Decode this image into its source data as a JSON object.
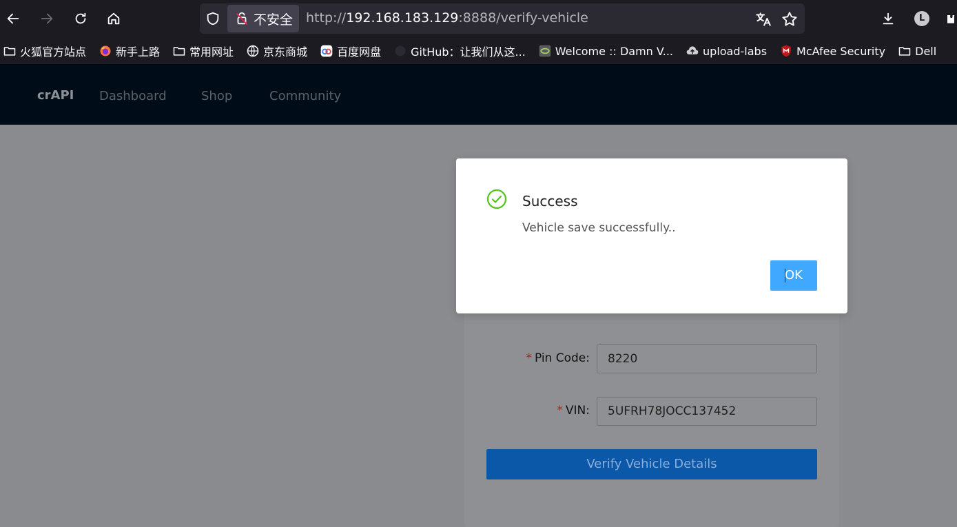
{
  "browser": {
    "security_label": "不安全",
    "url_prefix": "http://",
    "url_host": "192.168.183.129",
    "url_rest": ":8888/verify-vehicle",
    "profile_initial": "L"
  },
  "bookmarks": [
    {
      "label": "火狐官方站点",
      "icon": "folder-icon"
    },
    {
      "label": "新手上路",
      "icon": "firefox-icon"
    },
    {
      "label": "常用网址",
      "icon": "folder-icon"
    },
    {
      "label": "京东商城",
      "icon": "globe-icon"
    },
    {
      "label": "百度网盘",
      "icon": "baidu-pan-icon"
    },
    {
      "label": "GitHub：让我们从这...",
      "icon": "github-icon"
    },
    {
      "label": "Welcome :: Damn V...",
      "icon": "dvwa-icon"
    },
    {
      "label": "upload-labs",
      "icon": "upload-icon"
    },
    {
      "label": "McAfee Security",
      "icon": "mcafee-icon"
    },
    {
      "label": "Dell",
      "icon": "folder-icon"
    }
  ],
  "app": {
    "brand": "crAPI",
    "nav": [
      "Dashboard",
      "Shop",
      "Community"
    ]
  },
  "form": {
    "pin_label": "Pin Code",
    "pin_value": "8220",
    "vin_label": "VIN",
    "vin_value": "5UFRH78JOCC137452",
    "submit_label": "Verify Vehicle Details",
    "colon": ":"
  },
  "modal": {
    "title": "Success",
    "message": "Vehicle save successfully..",
    "ok_label": "OK",
    "ok_prefix": "",
    "ok_rest": "OK",
    "success_color": "#52c41a"
  }
}
